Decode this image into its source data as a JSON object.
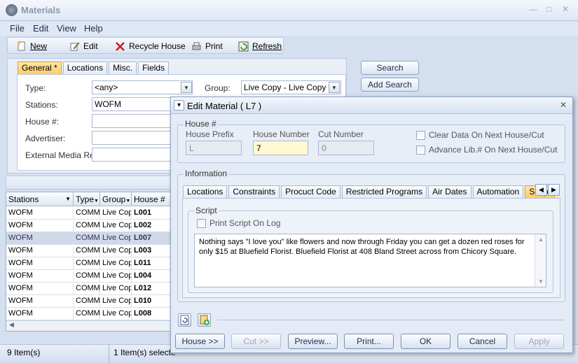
{
  "window": {
    "title": "Materials",
    "controls": {
      "close": "✕",
      "max": "□",
      "min": "—"
    }
  },
  "menu": [
    "File",
    "Edit",
    "View",
    "Help"
  ],
  "toolbar": {
    "new": "New",
    "edit": "Edit",
    "recycle": "Recycle House",
    "print": "Print",
    "refresh": "Refresh"
  },
  "search_tabs": [
    "General *",
    "Locations",
    "Misc.",
    "Fields"
  ],
  "search_form": {
    "type_label": "Type:",
    "type_value": "<any>",
    "group_label": "Group:",
    "group_value": "Live Copy - Live Copy",
    "stations_label": "Stations:",
    "stations_value": "WOFM",
    "house_label": "House #:",
    "advertiser_label": "Advertiser:",
    "extref_label": "External Media Ref:"
  },
  "search_buttons": {
    "search": "Search",
    "add_search": "Add Search"
  },
  "grid": {
    "headers": [
      "Stations",
      "Type",
      "Group",
      "House #"
    ],
    "rows": [
      [
        "WOFM",
        "COMME",
        "Live Cop",
        "L001"
      ],
      [
        "WOFM",
        "COMME",
        "Live Cop",
        "L002"
      ],
      [
        "WOFM",
        "COMME",
        "Live Cop",
        "L007"
      ],
      [
        "WOFM",
        "COMME",
        "Live Cop",
        "L003"
      ],
      [
        "WOFM",
        "COMME",
        "Live Cop",
        "L011"
      ],
      [
        "WOFM",
        "COMME",
        "Live Cop",
        "L004"
      ],
      [
        "WOFM",
        "COMME",
        "Live Cop",
        "L012"
      ],
      [
        "WOFM",
        "COMME",
        "Live Cop",
        "L010"
      ],
      [
        "WOFM",
        "COMME",
        "Live Cop",
        "L008"
      ]
    ],
    "selected_row": 2
  },
  "status": {
    "items": "9 Item(s)",
    "selected": "1 Item(s) selecte"
  },
  "dialog": {
    "title": "Edit Material  ( L7 )",
    "house_group": "House #",
    "house_prefix_label": "House Prefix",
    "house_prefix_value": "L",
    "house_number_label": "House Number",
    "house_number_value": "7",
    "cut_number_label": "Cut Number",
    "cut_number_value": "0",
    "clear_data": "Clear Data On Next House/Cut",
    "advance_lib": "Advance Lib.# On Next House/Cut",
    "info_group": "Information",
    "tabs": [
      "Locations",
      "Constraints",
      "Procuct Code",
      "Restricted Programs",
      "Air Dates",
      "Automation",
      "Script"
    ],
    "active_tab": "Script",
    "script_group": "Script",
    "print_script": "Print Script On Log",
    "script_text": "Nothing says \"I love you\" like flowers and now through Friday you can get a dozen red roses for only $15 at Bluefield Florist.  Bluefield Florist at 408 Bland Street across from Chicory Square.",
    "buttons": {
      "house": "House >>",
      "cut": "Cut >>",
      "preview": "Preview...",
      "print": "Print...",
      "ok": "OK",
      "cancel": "Cancel",
      "apply": "Apply"
    },
    "close": "✕"
  },
  "colors": {
    "accent_tab": "#ffcc66",
    "highlight_field": "#fff8d0",
    "selected_row": "#cfd9e8"
  }
}
